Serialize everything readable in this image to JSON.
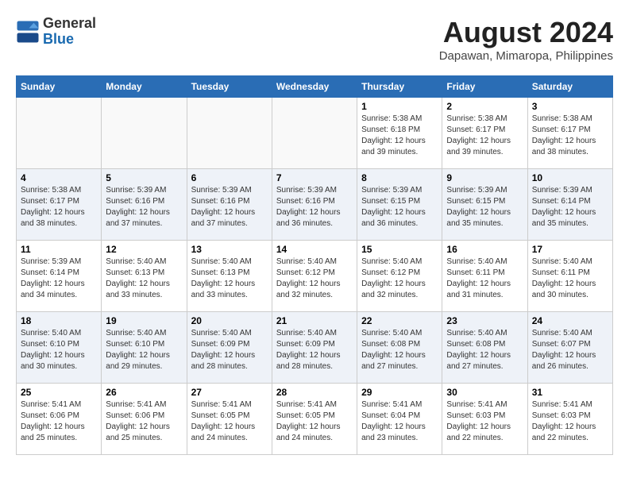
{
  "header": {
    "logo_general": "General",
    "logo_blue": "Blue",
    "month_year": "August 2024",
    "location": "Dapawan, Mimaropa, Philippines"
  },
  "days_of_week": [
    "Sunday",
    "Monday",
    "Tuesday",
    "Wednesday",
    "Thursday",
    "Friday",
    "Saturday"
  ],
  "weeks": [
    [
      {
        "day": "",
        "empty": true
      },
      {
        "day": "",
        "empty": true
      },
      {
        "day": "",
        "empty": true
      },
      {
        "day": "",
        "empty": true
      },
      {
        "day": "1",
        "sunrise": "5:38 AM",
        "sunset": "6:18 PM",
        "daylight": "12 hours and 39 minutes."
      },
      {
        "day": "2",
        "sunrise": "5:38 AM",
        "sunset": "6:17 PM",
        "daylight": "12 hours and 39 minutes."
      },
      {
        "day": "3",
        "sunrise": "5:38 AM",
        "sunset": "6:17 PM",
        "daylight": "12 hours and 38 minutes."
      }
    ],
    [
      {
        "day": "4",
        "sunrise": "5:38 AM",
        "sunset": "6:17 PM",
        "daylight": "12 hours and 38 minutes."
      },
      {
        "day": "5",
        "sunrise": "5:39 AM",
        "sunset": "6:16 PM",
        "daylight": "12 hours and 37 minutes."
      },
      {
        "day": "6",
        "sunrise": "5:39 AM",
        "sunset": "6:16 PM",
        "daylight": "12 hours and 37 minutes."
      },
      {
        "day": "7",
        "sunrise": "5:39 AM",
        "sunset": "6:16 PM",
        "daylight": "12 hours and 36 minutes."
      },
      {
        "day": "8",
        "sunrise": "5:39 AM",
        "sunset": "6:15 PM",
        "daylight": "12 hours and 36 minutes."
      },
      {
        "day": "9",
        "sunrise": "5:39 AM",
        "sunset": "6:15 PM",
        "daylight": "12 hours and 35 minutes."
      },
      {
        "day": "10",
        "sunrise": "5:39 AM",
        "sunset": "6:14 PM",
        "daylight": "12 hours and 35 minutes."
      }
    ],
    [
      {
        "day": "11",
        "sunrise": "5:39 AM",
        "sunset": "6:14 PM",
        "daylight": "12 hours and 34 minutes."
      },
      {
        "day": "12",
        "sunrise": "5:40 AM",
        "sunset": "6:13 PM",
        "daylight": "12 hours and 33 minutes."
      },
      {
        "day": "13",
        "sunrise": "5:40 AM",
        "sunset": "6:13 PM",
        "daylight": "12 hours and 33 minutes."
      },
      {
        "day": "14",
        "sunrise": "5:40 AM",
        "sunset": "6:12 PM",
        "daylight": "12 hours and 32 minutes."
      },
      {
        "day": "15",
        "sunrise": "5:40 AM",
        "sunset": "6:12 PM",
        "daylight": "12 hours and 32 minutes."
      },
      {
        "day": "16",
        "sunrise": "5:40 AM",
        "sunset": "6:11 PM",
        "daylight": "12 hours and 31 minutes."
      },
      {
        "day": "17",
        "sunrise": "5:40 AM",
        "sunset": "6:11 PM",
        "daylight": "12 hours and 30 minutes."
      }
    ],
    [
      {
        "day": "18",
        "sunrise": "5:40 AM",
        "sunset": "6:10 PM",
        "daylight": "12 hours and 30 minutes."
      },
      {
        "day": "19",
        "sunrise": "5:40 AM",
        "sunset": "6:10 PM",
        "daylight": "12 hours and 29 minutes."
      },
      {
        "day": "20",
        "sunrise": "5:40 AM",
        "sunset": "6:09 PM",
        "daylight": "12 hours and 28 minutes."
      },
      {
        "day": "21",
        "sunrise": "5:40 AM",
        "sunset": "6:09 PM",
        "daylight": "12 hours and 28 minutes."
      },
      {
        "day": "22",
        "sunrise": "5:40 AM",
        "sunset": "6:08 PM",
        "daylight": "12 hours and 27 minutes."
      },
      {
        "day": "23",
        "sunrise": "5:40 AM",
        "sunset": "6:08 PM",
        "daylight": "12 hours and 27 minutes."
      },
      {
        "day": "24",
        "sunrise": "5:40 AM",
        "sunset": "6:07 PM",
        "daylight": "12 hours and 26 minutes."
      }
    ],
    [
      {
        "day": "25",
        "sunrise": "5:41 AM",
        "sunset": "6:06 PM",
        "daylight": "12 hours and 25 minutes."
      },
      {
        "day": "26",
        "sunrise": "5:41 AM",
        "sunset": "6:06 PM",
        "daylight": "12 hours and 25 minutes."
      },
      {
        "day": "27",
        "sunrise": "5:41 AM",
        "sunset": "6:05 PM",
        "daylight": "12 hours and 24 minutes."
      },
      {
        "day": "28",
        "sunrise": "5:41 AM",
        "sunset": "6:05 PM",
        "daylight": "12 hours and 24 minutes."
      },
      {
        "day": "29",
        "sunrise": "5:41 AM",
        "sunset": "6:04 PM",
        "daylight": "12 hours and 23 minutes."
      },
      {
        "day": "30",
        "sunrise": "5:41 AM",
        "sunset": "6:03 PM",
        "daylight": "12 hours and 22 minutes."
      },
      {
        "day": "31",
        "sunrise": "5:41 AM",
        "sunset": "6:03 PM",
        "daylight": "12 hours and 22 minutes."
      }
    ]
  ],
  "labels": {
    "sunrise": "Sunrise:",
    "sunset": "Sunset:",
    "daylight": "Daylight:"
  }
}
